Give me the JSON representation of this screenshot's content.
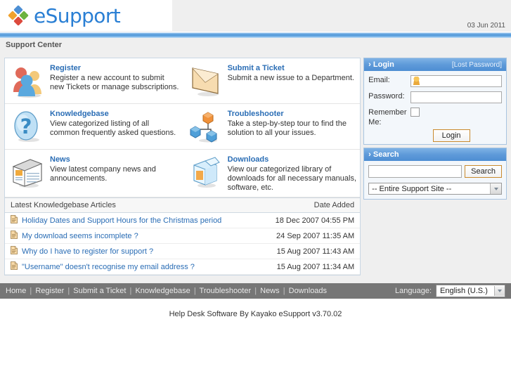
{
  "header": {
    "brand": "eSupport",
    "logo_icon": "diamond-pinwheel-logo",
    "date": "03 Jun 2011",
    "breadcrumb": "Support Center"
  },
  "features": [
    {
      "icon": "users-group-icon",
      "title": "Register",
      "desc": "Register a new account to submit new Tickets or manage subscriptions."
    },
    {
      "icon": "envelope-icon",
      "title": "Submit a Ticket",
      "desc": "Submit a new issue to a Department."
    },
    {
      "icon": "question-mark-icon",
      "title": "Knowledgebase",
      "desc": "View categorized listing of all common frequently asked questions."
    },
    {
      "icon": "network-nodes-icon",
      "title": "Troubleshooter",
      "desc": "Take a step-by-step tour to find the solution to all your issues."
    },
    {
      "icon": "newspaper-icon",
      "title": "News",
      "desc": "View latest company news and announcements."
    },
    {
      "icon": "open-box-icon",
      "title": "Downloads",
      "desc": "View our categorized library of downloads for all necessary manuals, software, etc."
    }
  ],
  "kb": {
    "header_title": "Latest Knowledgebase Articles",
    "header_date": "Date Added",
    "row_icon": "document-page-icon",
    "rows": [
      {
        "title": "Holiday Dates and Support Hours for the Christmas period",
        "date": "18 Dec 2007 04:55 PM"
      },
      {
        "title": "My download seems incomplete ?",
        "date": "24 Sep 2007 11:35 AM"
      },
      {
        "title": "Why do I have to register for support ?",
        "date": "15 Aug 2007 11:43 AM"
      },
      {
        "title": "\"Username\" doesn't recognise my email address ?",
        "date": "15 Aug 2007 11:34 AM"
      }
    ]
  },
  "login": {
    "panel_title": "Login",
    "lost_password": "[Lost Password]",
    "email_label": "Email:",
    "email_value": "",
    "email_icon": "user-avatar-icon",
    "password_label": "Password:",
    "password_value": "",
    "remember_label": "Remember Me:",
    "remember_checked": false,
    "button_label": "Login"
  },
  "search": {
    "panel_title": "Search",
    "query_value": "",
    "button_label": "Search",
    "scope_selected": "-- Entire Support Site --"
  },
  "footer": {
    "nav": [
      "Home",
      "Register",
      "Submit a Ticket",
      "Knowledgebase",
      "Troubleshooter",
      "News",
      "Downloads"
    ],
    "separator": "|",
    "language_label": "Language:",
    "language_selected": "English (U.S.)",
    "copyright": "Help Desk Software By Kayako eSupport v3.70.02"
  },
  "colors": {
    "link_blue": "#2a6db5",
    "brand_blue": "#2a7fd4",
    "panel_header_blue": "#5e9ad9",
    "footer_gray": "#767676",
    "page_bg": "#efefef",
    "button_border_orange": "#c98a2e"
  }
}
